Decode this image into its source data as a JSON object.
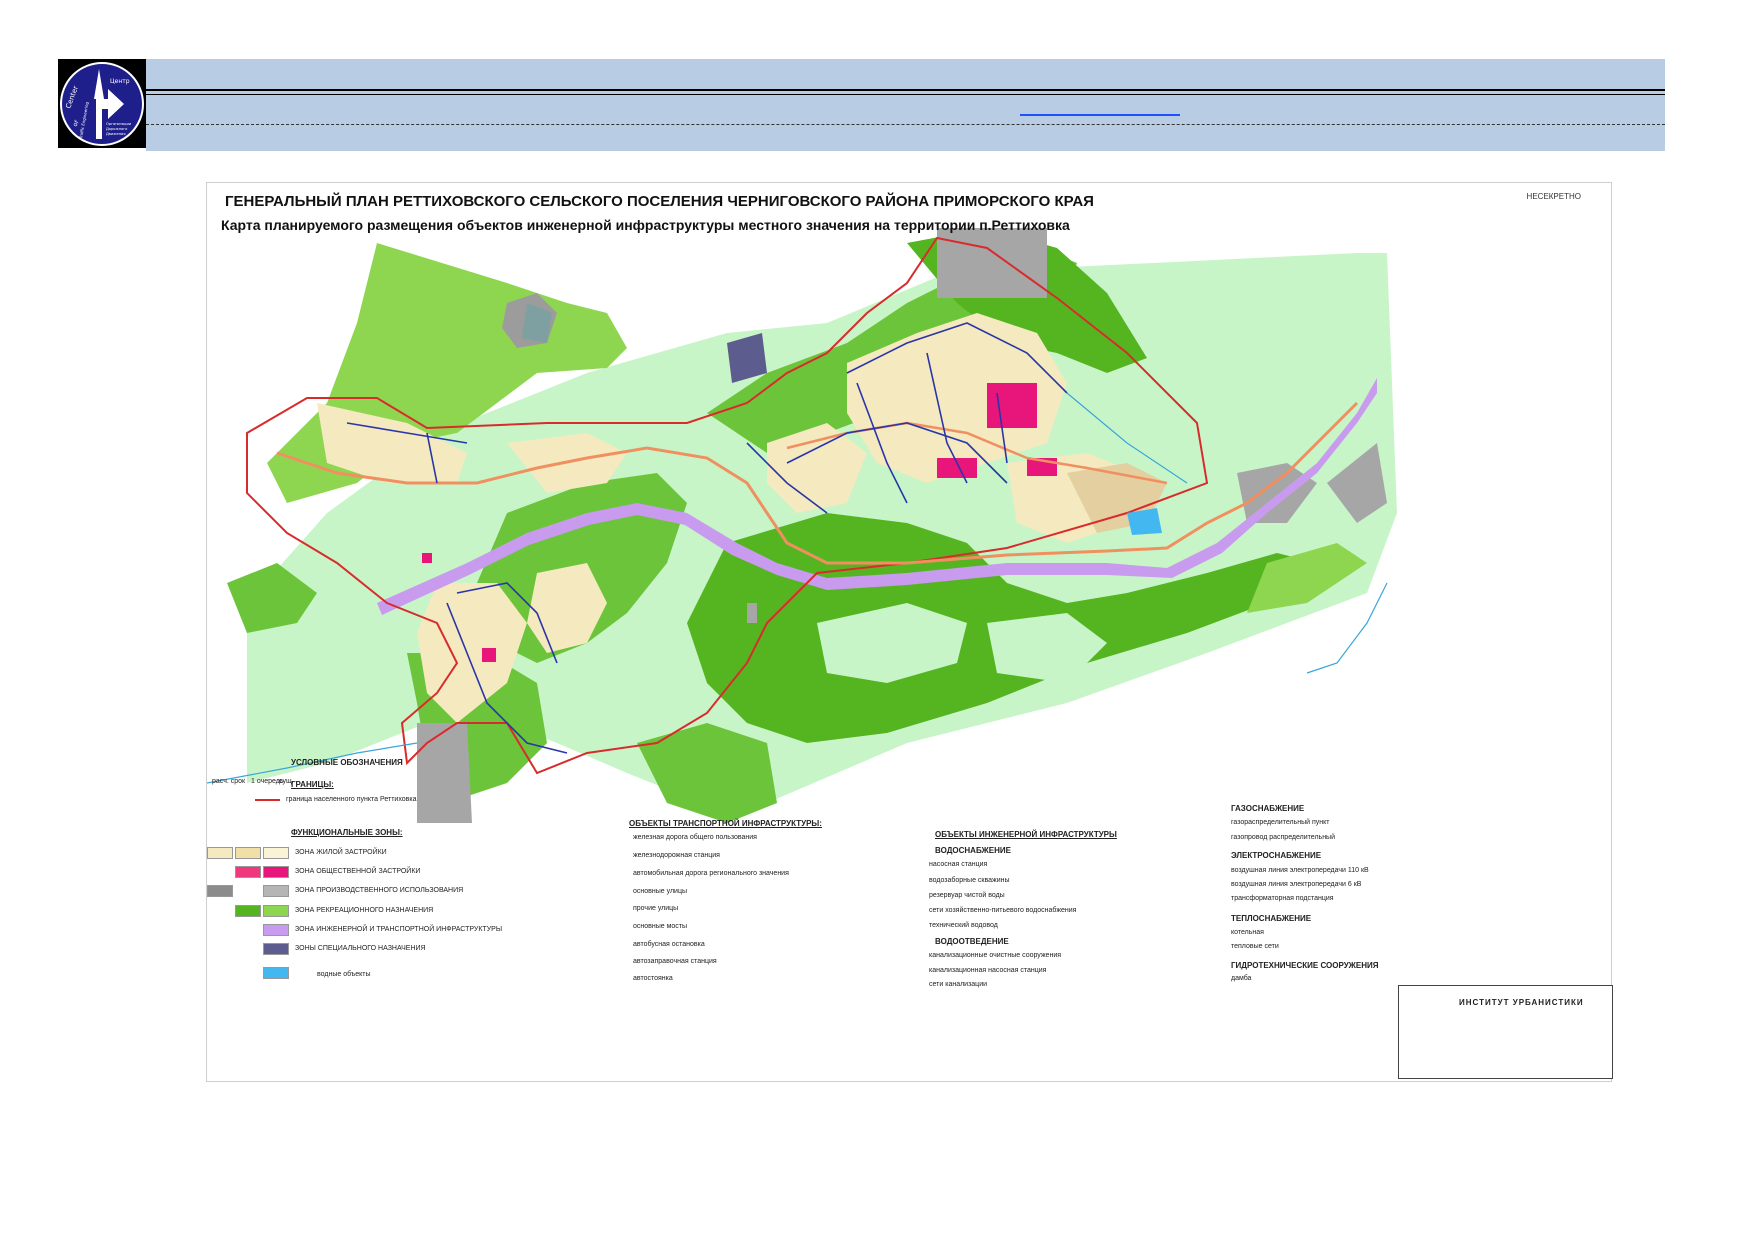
{
  "header": {
    "logo": {
      "lettering": [
        "Center",
        "of",
        "Traffic Engineering",
        "Центр",
        "Организации",
        "Дорожного",
        "Движения"
      ],
      "icon": "road-arrow-icon"
    },
    "band_color": "#b8cce4",
    "link_color": "#1f4fff"
  },
  "map": {
    "title": "ГЕНЕРАЛЬНЫЙ ПЛАН РЕТТИХОВСКОГО СЕЛЬСКОГО ПОСЕЛЕНИЯ ЧЕРНИГОВСКОГО РАЙОНА ПРИМОРСКОГО КРАЯ",
    "subtitle": "Карта планируемого размещения объектов инженерной инфраструктуры местного значения на территории п.Реттиховка",
    "secrecy": "НЕСЕКРЕТНО",
    "colors": {
      "recreation_dark": "#55b520",
      "recreation_light": "#8fd650",
      "meadow": "#c8f5c8",
      "residential": "#f4e9bf",
      "public": "#e8157a",
      "industrial": "#9c9c9c",
      "transport": "#c89bef",
      "special": "#5c5c8e",
      "boundary": "#d82c2c",
      "water_lines": "#3aa6d8",
      "engineering": "#2a36a8",
      "regional_road": "#f09060"
    }
  },
  "legend": {
    "title": "УСЛОВНЫЕ ОБОЗНАЧЕНИЯ",
    "boundaries_head": "ГРАНИЦЫ:",
    "boundary_item": "граница населенного пункта Реттиховка",
    "zones_head": "ФУНКЦИОНАЛЬНЫЕ ЗОНЫ:",
    "zones": [
      {
        "label": "ЗОНА ЖИЛОЙ ЗАСТРОЙКИ",
        "color": "#f4e9bf"
      },
      {
        "label": "ЗОНА ОБЩЕСТВЕННОЙ ЗАСТРОЙКИ",
        "color": "#e8157a"
      },
      {
        "label": "ЗОНА ПРОИЗВОДСТВЕННОГО ИСПОЛЬЗОВАНИЯ",
        "color": "#a6a6a6"
      },
      {
        "label": "ЗОНА РЕКРЕАЦИОННОГО НАЗНАЧЕНИЯ",
        "color": "#6cc43a"
      },
      {
        "label": "ЗОНА ИНЖЕНЕРНОЙ И ТРАНСПОРТНОЙ ИНФРАСТРУКТУРЫ",
        "color": "#c89bef"
      },
      {
        "label": "ЗОНЫ СПЕЦИАЛЬНОГО НАЗНАЧЕНИЯ",
        "color": "#5c5c8e"
      },
      {
        "label": "водные объекты",
        "color": "#43b8f0"
      }
    ],
    "transport_head": "ОБЪЕКТЫ ТРАНСПОРТНОЙ ИНФРАСТРУКТУРЫ:",
    "transport_items": [
      "железная дорога общего пользования",
      "железнодорожная станция",
      "автомобильная дорога регионального значения",
      "основные улицы",
      "прочие улицы",
      "основные мосты",
      "автобусная остановка",
      "автозаправочная станция",
      "автостоянка"
    ],
    "engineering_head": "ОБЪЕКТЫ ИНЖЕНЕРНОЙ ИНФРАСТРУКТУРЫ",
    "water_head": "ВОДОСНАБЖЕНИЕ",
    "water_items": [
      "насосная станция",
      "водозаборные скважины",
      "резервуар чистой воды",
      "сети хозяйственно-питьевого водоснабжения",
      "технический водовод"
    ],
    "sewer_head": "ВОДООТВЕДЕНИЕ",
    "sewer_items": [
      "канализационные очистные сооружения",
      "канализационная насосная станция",
      "сети канализации"
    ],
    "gas_head": "ГАЗОСНАБЖЕНИЕ",
    "gas_items": [
      "газораспределительный пункт",
      "газопровод распределительный"
    ],
    "power_head": "ЭЛЕКТРОСНАБЖЕНИЕ",
    "power_items": [
      "воздушная линия электропередачи 110 кВ",
      "воздушная линия электропередачи 6 кВ",
      "трансформаторная подстанция"
    ],
    "heat_head": "ТЕПЛОСНАБЖЕНИЕ",
    "heat_items": [
      "котельная",
      "тепловые сети"
    ],
    "hydro_head": "ГИДРОТЕХНИЧЕСКИЕ СООРУЖЕНИЯ",
    "hydro_items": [
      "дамба"
    ],
    "column_headers": [
      "сущ.",
      "1 очередь",
      "расч. срок"
    ]
  },
  "stamp": {
    "institute": "ИНСТИТУТ УРБАНИСТИКИ"
  }
}
